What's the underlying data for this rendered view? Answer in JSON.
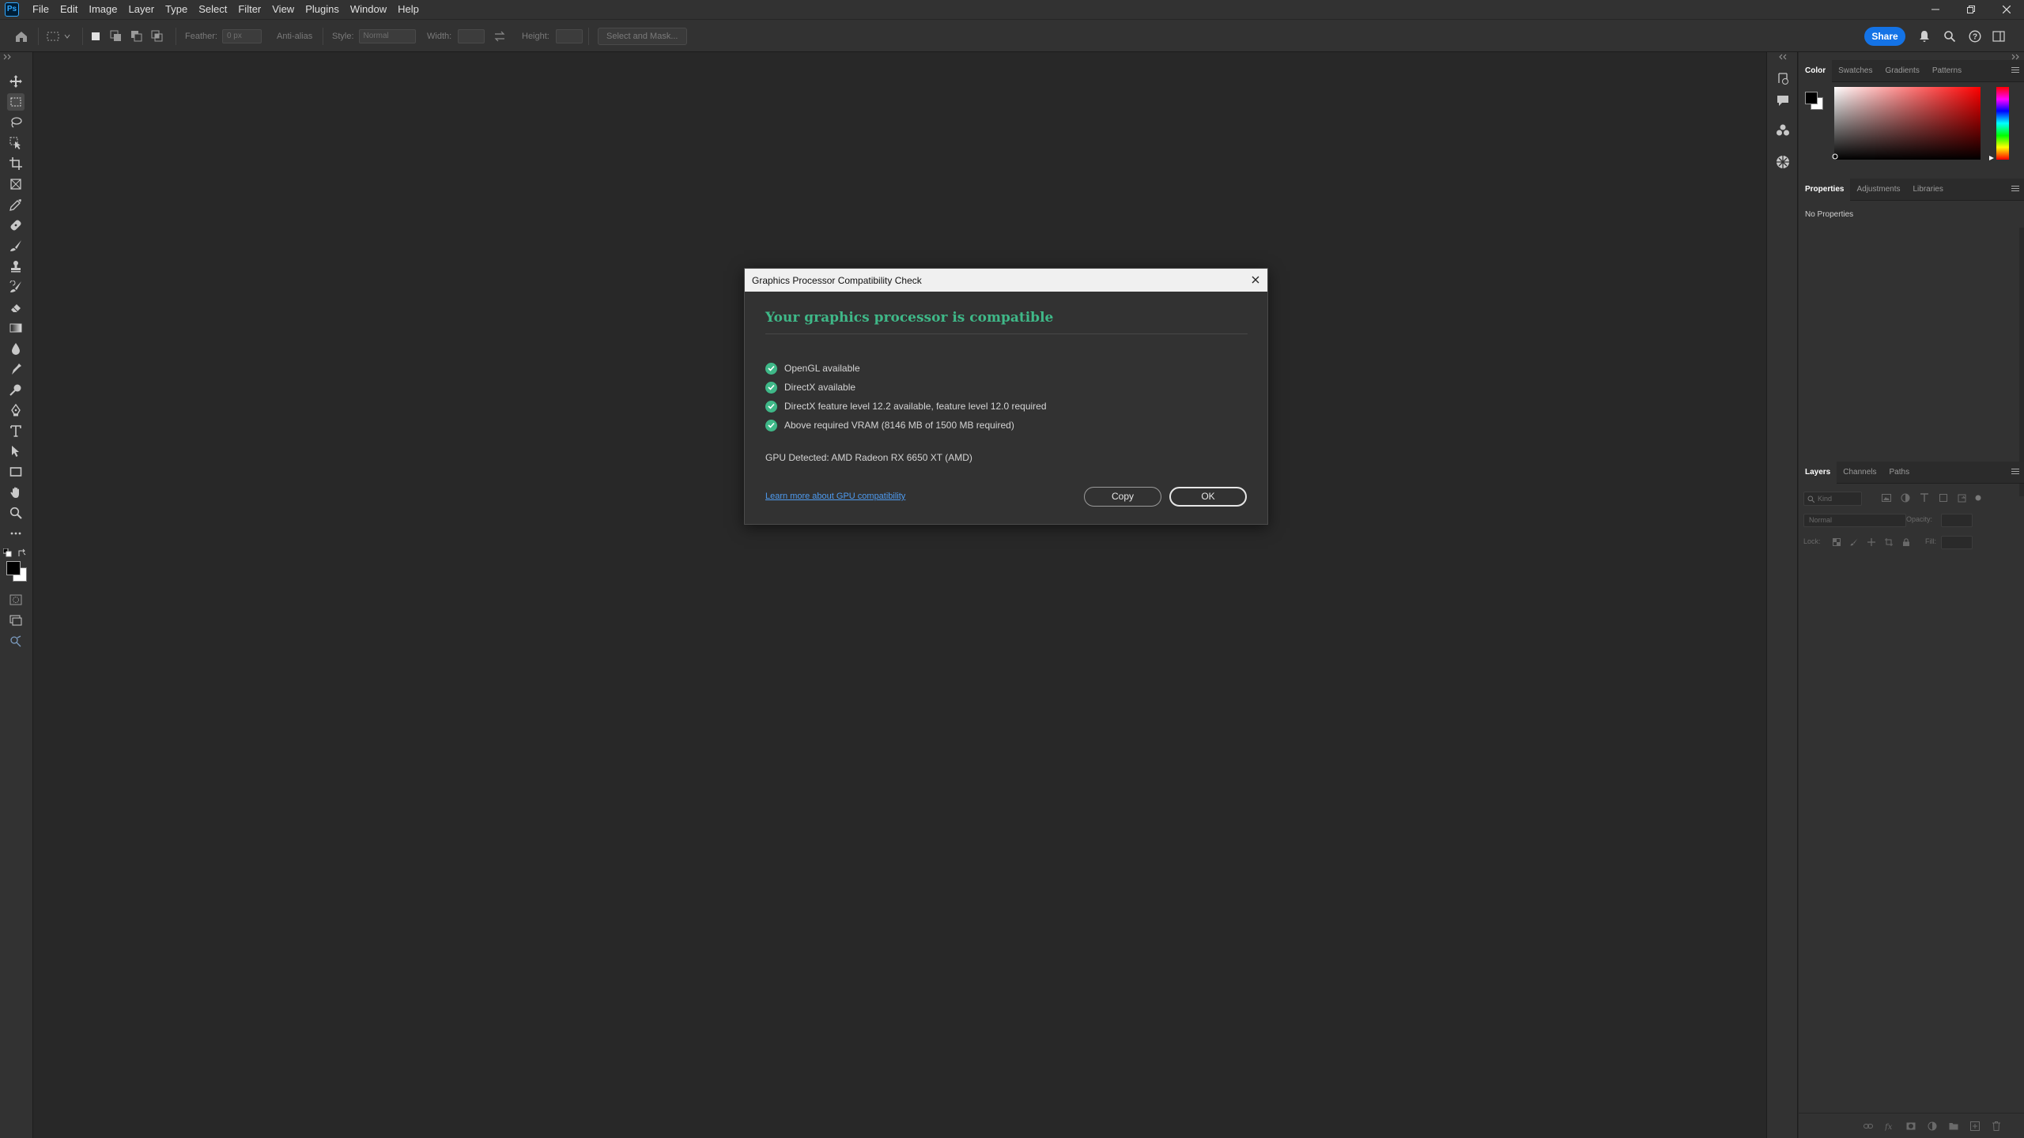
{
  "app": {
    "logo_text": "Ps",
    "accent_color": "#1473e6",
    "success_color": "#3fb888",
    "link_color": "#4e9bf0"
  },
  "menubar": {
    "items": [
      "File",
      "Edit",
      "Image",
      "Layer",
      "Type",
      "Select",
      "Filter",
      "View",
      "Plugins",
      "Window",
      "Help"
    ],
    "window_controls": [
      "minimize-icon",
      "restore-icon",
      "close-icon"
    ]
  },
  "options_bar": {
    "feather_label": "Feather:",
    "feather_value": "0 px",
    "antialias_label": "Anti-alias",
    "style_label": "Style:",
    "style_value": "Normal",
    "width_label": "Width:",
    "height_label": "Height:",
    "select_mask_label": "Select and Mask...",
    "share_label": "Share",
    "right_icons": [
      "bell-icon",
      "search-icon",
      "help-icon",
      "workspace-icon"
    ]
  },
  "toolbar": {
    "tools": [
      "move-tool-icon",
      "marquee-tool-icon",
      "lasso-tool-icon",
      "object-select-tool-icon",
      "crop-tool-icon",
      "frame-tool-icon",
      "eyedropper-tool-icon",
      "healing-brush-tool-icon",
      "brush-tool-icon",
      "clone-stamp-tool-icon",
      "history-brush-tool-icon",
      "eraser-tool-icon",
      "gradient-tool-icon",
      "blur-tool-icon",
      "smudge-tool-icon",
      "dodge-tool-icon",
      "pen-tool-icon",
      "type-tool-icon",
      "path-select-tool-icon",
      "rectangle-tool-icon",
      "hand-tool-icon",
      "zoom-tool-icon",
      "more-tools-icon"
    ]
  },
  "panels": {
    "color": {
      "tabs": [
        "Color",
        "Swatches",
        "Gradients",
        "Patterns"
      ],
      "active_tab": "Color",
      "foreground": "#000000",
      "background": "#ffffff",
      "hue": "#ff0000"
    },
    "properties": {
      "tabs": [
        "Properties",
        "Adjustments",
        "Libraries"
      ],
      "active_tab": "Properties",
      "empty_text": "No Properties"
    },
    "layers": {
      "tabs": [
        "Layers",
        "Channels",
        "Paths"
      ],
      "active_tab": "Layers",
      "search_placeholder": "Kind",
      "blend_mode": "Normal",
      "opacity_label": "Opacity:",
      "lock_label": "Lock:",
      "fill_label": "Fill:",
      "bottom_icons": [
        "link-icon",
        "fx-icon",
        "mask-icon",
        "adjustment-icon",
        "folder-icon",
        "new-layer-icon",
        "trash-icon"
      ]
    }
  },
  "dialog": {
    "title": "Graphics Processor Compatibility Check",
    "heading": "Your graphics processor is compatible",
    "checks": [
      "OpenGL available",
      "DirectX available",
      "DirectX feature level 12.2 available, feature level 12.0 required",
      "Above required VRAM (8146 MB of 1500 MB required)"
    ],
    "gpu_detected": "GPU Detected: AMD Radeon RX 6650 XT (AMD)",
    "learn_more": "Learn more about GPU compatibility",
    "copy_label": "Copy",
    "ok_label": "OK"
  }
}
